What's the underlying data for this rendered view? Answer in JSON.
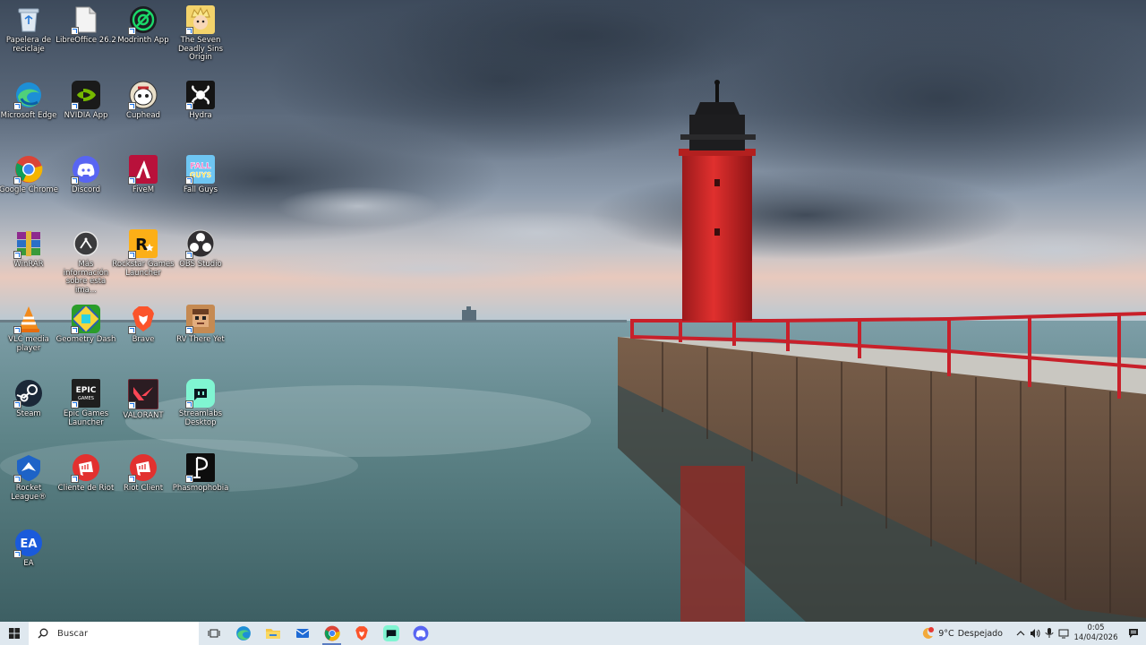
{
  "desktop": {
    "icons": [
      {
        "label": "Papelera de reciclaje",
        "icon": "recycle-bin-icon"
      },
      {
        "label": "LibreOffice 26.2",
        "icon": "libreoffice-icon"
      },
      {
        "label": "Modrinth App",
        "icon": "modrinth-icon"
      },
      {
        "label": "The Seven Deadly Sins Origin",
        "icon": "seven-deadly-sins-icon"
      },
      {
        "label": "Microsoft Edge",
        "icon": "edge-icon"
      },
      {
        "label": "NVIDIA App",
        "icon": "nvidia-icon"
      },
      {
        "label": "Cuphead",
        "icon": "cuphead-icon"
      },
      {
        "label": "Hydra",
        "icon": "hydra-icon"
      },
      {
        "label": "Google Chrome",
        "icon": "chrome-icon"
      },
      {
        "label": "Discord",
        "icon": "discord-icon"
      },
      {
        "label": "FiveM",
        "icon": "fivem-icon"
      },
      {
        "label": "Fall Guys",
        "icon": "fall-guys-icon"
      },
      {
        "label": "WinRAR",
        "icon": "winrar-icon"
      },
      {
        "label": "Más información sobre esta ima...",
        "icon": "info-icon"
      },
      {
        "label": "Rockstar Games Launcher",
        "icon": "rockstar-icon"
      },
      {
        "label": "OBS Studio",
        "icon": "obs-icon"
      },
      {
        "label": "VLC media player",
        "icon": "vlc-icon"
      },
      {
        "label": "Geometry Dash",
        "icon": "geometry-dash-icon"
      },
      {
        "label": "Brave",
        "icon": "brave-icon"
      },
      {
        "label": "RV There Yet",
        "icon": "rv-there-yet-icon"
      },
      {
        "label": "Steam",
        "icon": "steam-icon"
      },
      {
        "label": "Epic Games Launcher",
        "icon": "epic-games-icon"
      },
      {
        "label": "VALORANT",
        "icon": "valorant-icon"
      },
      {
        "label": "Streamlabs Desktop",
        "icon": "streamlabs-icon"
      },
      {
        "label": "Rocket League®",
        "icon": "rocket-league-icon"
      },
      {
        "label": "Cliente de Riot",
        "icon": "riot-icon"
      },
      {
        "label": "Riot Client",
        "icon": "riot-icon"
      },
      {
        "label": "Phasmophobia",
        "icon": "phasmophobia-icon"
      },
      {
        "label": "EA",
        "icon": "ea-icon"
      }
    ]
  },
  "taskbar": {
    "search_placeholder": "Buscar",
    "pinned": [
      "task-view-icon",
      "edge-icon",
      "file-explorer-icon",
      "mail-icon",
      "chrome-icon",
      "brave-icon",
      "streamlabs-icon",
      "discord-icon"
    ],
    "active_app": "chrome-icon",
    "weather": {
      "temp": "9°C",
      "condition": "Despejado"
    },
    "clock": {
      "time": "0:05",
      "date": "14/04/2026"
    }
  },
  "colors": {
    "taskbar_bg": "#dfe8ef",
    "lighthouse_red": "#d8262a",
    "railing_red": "#c8202a"
  }
}
